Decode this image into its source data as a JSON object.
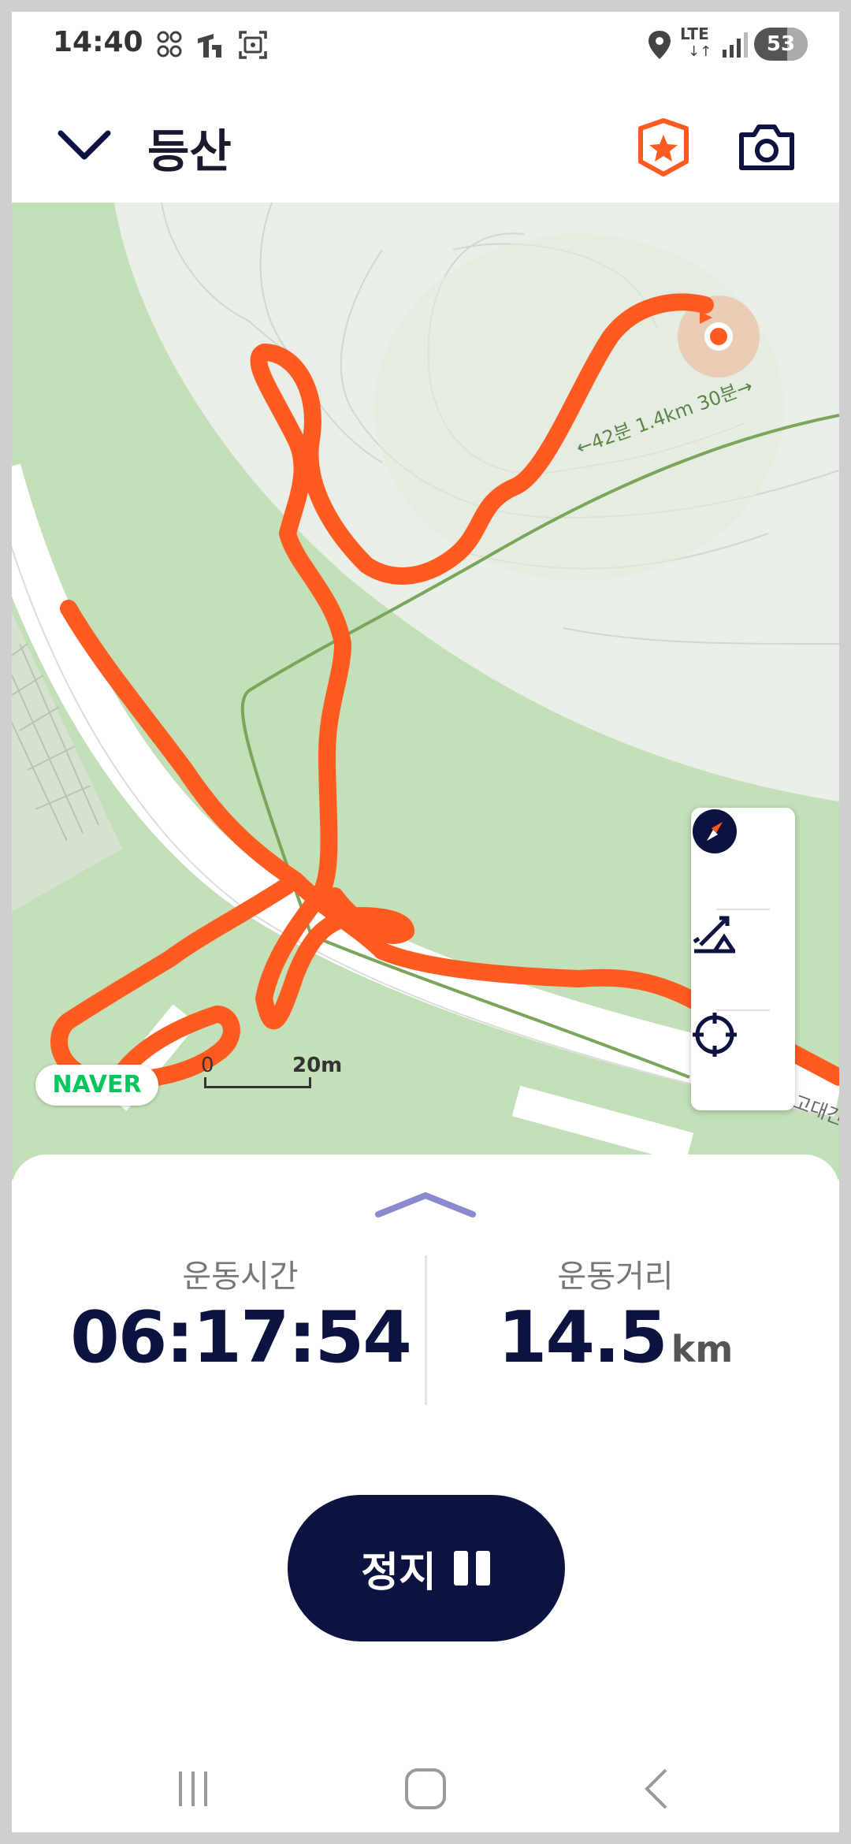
{
  "status_bar": {
    "time": "14:40",
    "battery": "53",
    "network": "LTE",
    "icons": [
      "sync-icon",
      "carrier-icon",
      "screenshot-icon",
      "location-icon",
      "signal-icon",
      "battery-icon"
    ]
  },
  "header": {
    "title": "등산",
    "back_icon": "chevron-down-icon",
    "badge_icon": "star-badge-icon",
    "camera_icon": "camera-icon"
  },
  "map": {
    "provider_logo": "NAVER",
    "trail_label": "←42분 1.4km 30분→",
    "scale_start": "0",
    "scale_end": "20m",
    "edge_label": "고대간",
    "controls": [
      "compass-icon",
      "terrain-icon",
      "locate-icon"
    ],
    "route_color": "#ff5a1f"
  },
  "stats": {
    "time_label": "운동시간",
    "time_value": "06:17:54",
    "distance_label": "운동거리",
    "distance_value": "14.5",
    "distance_unit": "km"
  },
  "actions": {
    "stop_label": "정지"
  },
  "nav_bar": [
    "recents-icon",
    "home-icon",
    "back-icon"
  ]
}
